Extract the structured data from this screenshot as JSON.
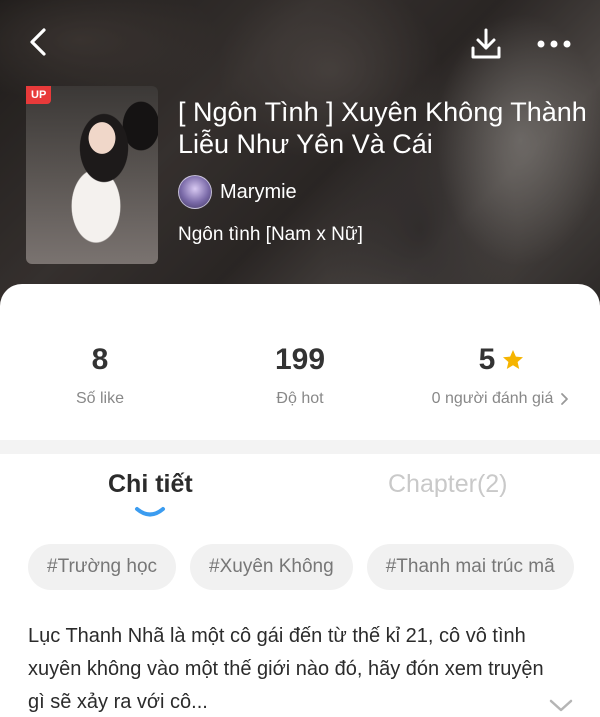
{
  "header": {
    "back_icon": "chevron-left-icon",
    "download_icon": "download-icon",
    "more_icon": "more-horizontal-icon"
  },
  "book": {
    "badge": "UP",
    "title": "[ Ngôn Tình ] Xuyên Không Thành Liễu Như Yên Và Cái",
    "author": "Marymie",
    "genre": "Ngôn tình [Nam x Nữ]"
  },
  "stats": [
    {
      "value": "8",
      "label": "Số like"
    },
    {
      "value": "199",
      "label": "Độ hot"
    },
    {
      "value": "5",
      "label": "0 người đánh giá"
    }
  ],
  "tabs": [
    {
      "label": "Chi tiết",
      "active": true
    },
    {
      "label": "Chapter(2)",
      "active": false
    }
  ],
  "tags": [
    "#Trường học",
    "#Xuyên Không",
    "#Thanh mai trúc mã"
  ],
  "description": "Lục Thanh Nhã là một cô gái đến từ thế kỉ 21, cô vô tình xuyên không vào một thế giới nào đó, hãy đón xem truyện gì sẽ xảy ra với cô...",
  "colors": {
    "accent": "#3b9cf0",
    "star": "#f5b400",
    "badge": "#e83a3a"
  }
}
